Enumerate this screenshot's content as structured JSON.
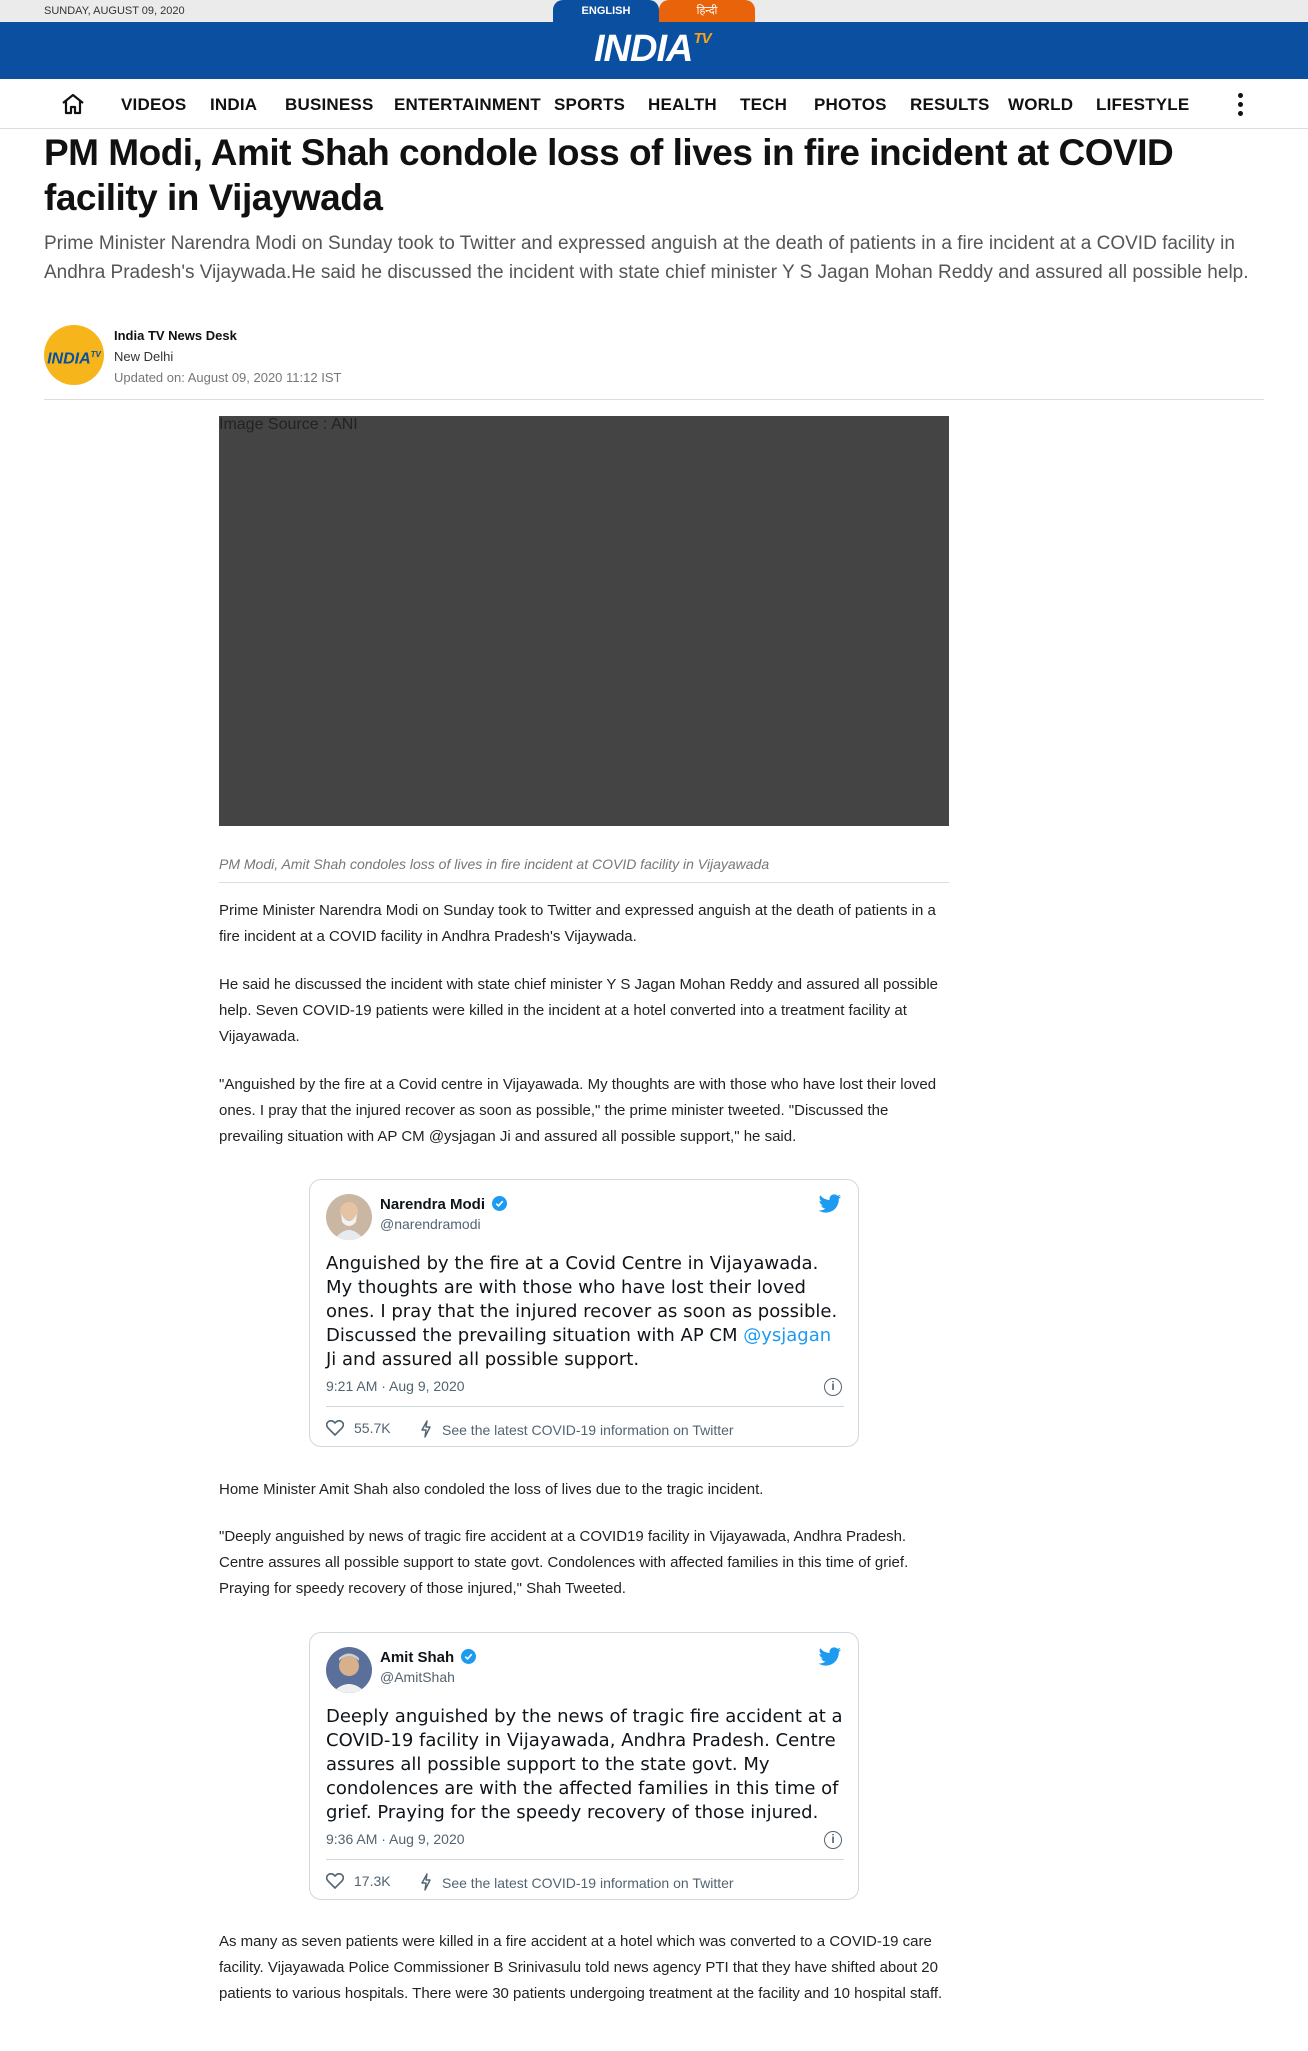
{
  "topbar": {
    "date": "SUNDAY, AUGUST 09, 2020",
    "lang_english": "ENGLISH",
    "lang_hindi": "हिन्दी"
  },
  "brand": {
    "logo_main": "INDIA",
    "logo_sup": "TV",
    "primary_color": "#0a4fa0",
    "accent_color": "#e8630a"
  },
  "nav": {
    "home_icon": "home-icon",
    "items": [
      "VIDEOS",
      "INDIA",
      "BUSINESS",
      "ENTERTAINMENT",
      "SPORTS",
      "HEALTH",
      "TECH",
      "PHOTOS",
      "RESULTS",
      "WORLD",
      "LIFESTYLE"
    ],
    "more_icon": "more-vertical-icon"
  },
  "article": {
    "headline": "PM Modi, Amit Shah condole loss of lives in fire incident at COVID facility in Vijaywada",
    "summary": "Prime Minister Narendra Modi on Sunday took to Twitter and expressed anguish at the death of patients in a fire incident at a COVID facility in Andhra Pradesh's Vijaywada.He said he discussed the incident with state chief minister Y S Jagan Mohan Reddy and assured all possible help.",
    "author": {
      "logo_text": "INDIA",
      "logo_sup": "TV",
      "name": "India TV News Desk",
      "location": "New Delhi",
      "updated": "Updated on: August 09, 2020 11:12 IST"
    },
    "image_credit": "Image Source : ANI",
    "image_caption": "PM Modi, Amit Shah condoles loss of lives in fire incident at COVID facility in Vijayawada",
    "paragraphs": [
      "Prime Minister Narendra Modi on Sunday took to Twitter and expressed anguish at the death of patients in a fire incident at a COVID facility in Andhra Pradesh's Vijaywada.",
      "He said he discussed the incident with state chief minister Y S Jagan Mohan Reddy and assured all possible help. Seven COVID-19 patients were killed in the incident at a hotel converted into a treatment facility at Vijayawada.",
      "\"Anguished by the fire at a Covid centre in Vijayawada. My thoughts are with those who have lost their loved ones. I pray that the injured recover as soon as possible,\" the prime minister tweeted. \"Discussed the prevailing situation with AP CM @ysjagan Ji and assured all possible support,\" he said.",
      "Home Minister Amit Shah also condoled the loss of lives due to the tragic incident.",
      "\"Deeply anguished by news of tragic fire accident at a COVID19 facility in Vijayawada, Andhra Pradesh. Centre assures all possible support to state govt. Condolences with affected families in this time of grief. Praying for speedy recovery of those injured,\" Shah Tweeted.",
      " As many as seven patients were killed in a fire accident at a hotel which was converted to a COVID-19 care facility. Vijayawada Police Commissioner B Srinivasulu told news agency PTI that they have shifted about 20 patients to various hospitals. There were 30 patients undergoing treatment at the facility and 10 hospital staff."
    ]
  },
  "tweets": [
    {
      "name": "Narendra Modi",
      "handle": "@narendramodi",
      "text_before": "Anguished by the fire at a Covid Centre in Vijayawada. My thoughts are with those who have lost their loved ones. I pray that the injured recover as soon as possible. Discussed the prevailing situation with AP CM ",
      "mention": "@ysjagan",
      "text_after": " Ji and assured all possible support.",
      "time": "9:21 AM · Aug 9, 2020",
      "likes": "55.7K",
      "covid_link": "See the latest COVID-19 information on Twitter"
    },
    {
      "name": "Amit Shah",
      "handle": "@AmitShah",
      "text_before": "Deeply anguished by the news of tragic fire accident at a COVID-19 facility in Vijayawada, Andhra Pradesh. Centre assures all possible support to the state govt. My condolences are with the affected families in this time of grief. Praying for the speedy recovery of those injured.",
      "mention": "",
      "text_after": "",
      "time": "9:36 AM · Aug 9, 2020",
      "likes": "17.3K",
      "covid_link": "See the latest COVID-19 information on Twitter"
    }
  ]
}
